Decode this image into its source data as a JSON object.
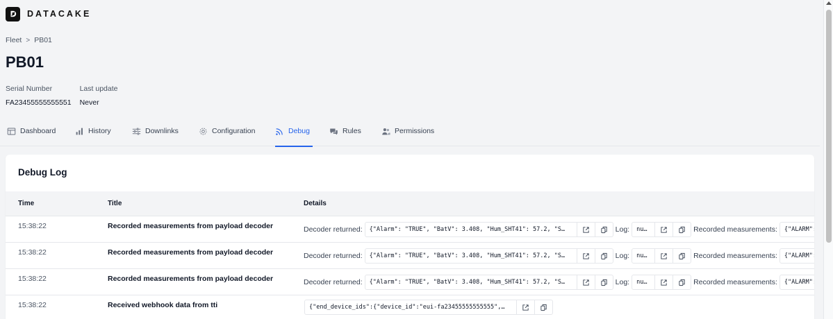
{
  "app": {
    "logo_text": "DATACAKE",
    "accent_color": "#2563eb"
  },
  "breadcrumb": {
    "parent": "Fleet",
    "separator": ">",
    "current": "PB01"
  },
  "page_title": "PB01",
  "meta": {
    "serial_label": "Serial Number",
    "serial_value": "FA23455555555551",
    "update_label": "Last update",
    "update_value": "Never"
  },
  "tabs": [
    {
      "label": "Dashboard",
      "icon": "table-icon"
    },
    {
      "label": "History",
      "icon": "bar-chart-icon"
    },
    {
      "label": "Downlinks",
      "icon": "sliders-icon"
    },
    {
      "label": "Configuration",
      "icon": "gear-icon"
    },
    {
      "label": "Debug",
      "icon": "rss-icon",
      "active": true
    },
    {
      "label": "Rules",
      "icon": "chat-icon"
    },
    {
      "label": "Permissions",
      "icon": "users-icon"
    }
  ],
  "debug_log": {
    "title": "Debug Log",
    "columns": [
      "Time",
      "Title",
      "Details"
    ],
    "rows": [
      {
        "time": "15:38:22",
        "title": "Recorded measurements from payload decoder",
        "decoder_label": "Decoder returned:",
        "decoder_value": "{\"Alarm\": \"TRUE\", \"BatV\": 3.408, \"Hum_SHT41\": 57.2, \"S…",
        "log_label": "Log:",
        "log_value": "null",
        "measurements_label": "Recorded measurements:",
        "measurements_value": "{\"ALARM\": \""
      },
      {
        "time": "15:38:22",
        "title": "Recorded measurements from payload decoder",
        "decoder_label": "Decoder returned:",
        "decoder_value": "{\"Alarm\": \"TRUE\", \"BatV\": 3.408, \"Hum_SHT41\": 57.2, \"S…",
        "log_label": "Log:",
        "log_value": "null",
        "measurements_label": "Recorded measurements:",
        "measurements_value": "{\"ALARM\": \""
      },
      {
        "time": "15:38:22",
        "title": "Recorded measurements from payload decoder",
        "decoder_label": "Decoder returned:",
        "decoder_value": "{\"Alarm\": \"TRUE\", \"BatV\": 3.408, \"Hum_SHT41\": 57.2, \"S…",
        "log_label": "Log:",
        "log_value": "null",
        "measurements_label": "Recorded measurements:",
        "measurements_value": "{\"ALARM\": \""
      },
      {
        "time": "15:38:22",
        "title": "Received webhook data from tti",
        "webhook_value": "{\"end_device_ids\":{\"device_id\":\"eui-fa23455555555555\",…"
      }
    ]
  }
}
